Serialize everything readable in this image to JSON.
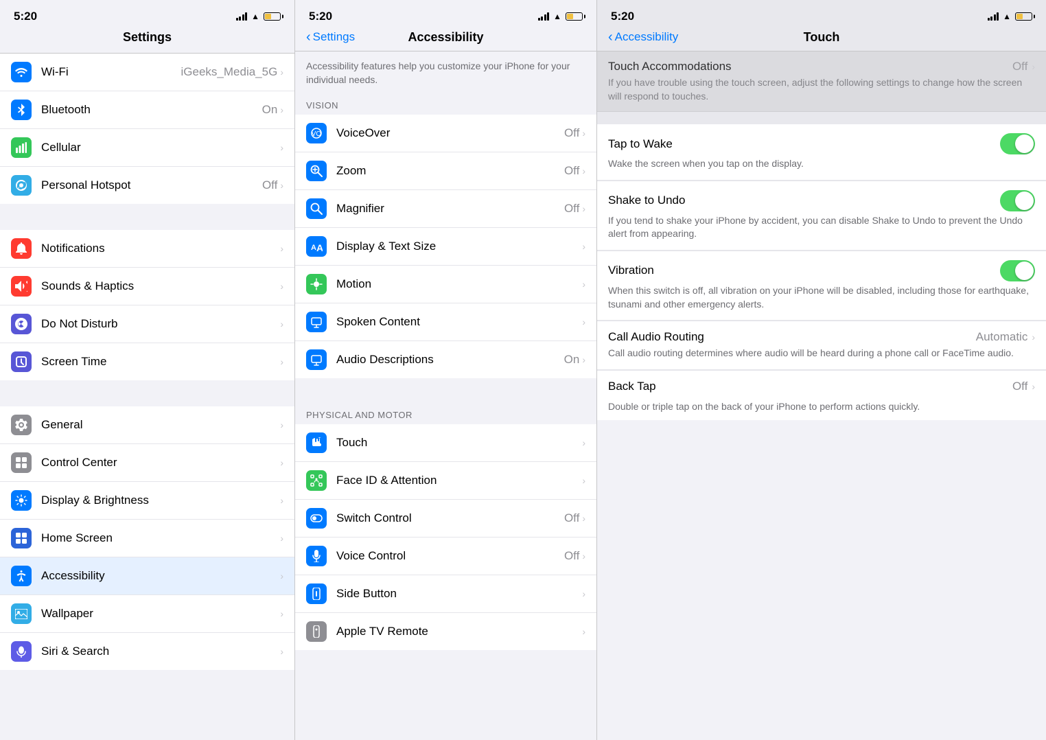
{
  "panels": {
    "left": {
      "status_time": "5:20",
      "nav_title": "Settings",
      "rows": [
        {
          "id": "wifi",
          "icon": "📶",
          "icon_color": "icon-blue",
          "label": "Wi-Fi",
          "value": "iGeeks_Media_5G",
          "has_chevron": true
        },
        {
          "id": "bluetooth",
          "icon": "🔵",
          "icon_color": "icon-blue2",
          "label": "Bluetooth",
          "value": "On",
          "has_chevron": true
        },
        {
          "id": "cellular",
          "icon": "📡",
          "icon_color": "icon-green",
          "label": "Cellular",
          "value": "",
          "has_chevron": true
        },
        {
          "id": "hotspot",
          "icon": "🔗",
          "icon_color": "icon-green2",
          "label": "Personal Hotspot",
          "value": "Off",
          "has_chevron": true
        },
        {
          "id": "notifications",
          "icon": "🔔",
          "icon_color": "icon-red",
          "label": "Notifications",
          "value": "",
          "has_chevron": true
        },
        {
          "id": "sounds",
          "icon": "🔊",
          "icon_color": "icon-red",
          "label": "Sounds & Haptics",
          "value": "",
          "has_chevron": true
        },
        {
          "id": "donotdisturb",
          "icon": "🌙",
          "icon_color": "icon-purple",
          "label": "Do Not Disturb",
          "value": "",
          "has_chevron": true
        },
        {
          "id": "screentime",
          "icon": "⏱",
          "icon_color": "icon-purple",
          "label": "Screen Time",
          "value": "",
          "has_chevron": true
        },
        {
          "id": "general",
          "icon": "⚙️",
          "icon_color": "icon-gray",
          "label": "General",
          "value": "",
          "has_chevron": true
        },
        {
          "id": "controlcenter",
          "icon": "☰",
          "icon_color": "icon-gray",
          "label": "Control Center",
          "value": "",
          "has_chevron": true
        },
        {
          "id": "displaybrightness",
          "icon": "AA",
          "icon_color": "icon-blue",
          "label": "Display & Brightness",
          "value": "",
          "has_chevron": true
        },
        {
          "id": "homescreen",
          "icon": "⊞",
          "icon_color": "icon-blue",
          "label": "Home Screen",
          "value": "",
          "has_chevron": true
        },
        {
          "id": "accessibility",
          "icon": "♿",
          "icon_color": "icon-blue",
          "label": "Accessibility",
          "value": "",
          "has_chevron": true,
          "selected": true
        },
        {
          "id": "wallpaper",
          "icon": "🖼",
          "icon_color": "icon-teal",
          "label": "Wallpaper",
          "value": "",
          "has_chevron": true
        },
        {
          "id": "siri",
          "icon": "🎙",
          "icon_color": "icon-indigo",
          "label": "Siri & Search",
          "value": "",
          "has_chevron": true
        }
      ]
    },
    "mid": {
      "status_time": "5:20",
      "back_label": "Settings",
      "nav_title": "Accessibility",
      "description": "Accessibility features help you customize your iPhone for your individual needs.",
      "section_vision": "VISION",
      "vision_items": [
        {
          "id": "voiceover",
          "label": "VoiceOver",
          "value": "Off",
          "has_chevron": true
        },
        {
          "id": "zoom",
          "label": "Zoom",
          "value": "Off",
          "has_chevron": true
        },
        {
          "id": "magnifier",
          "label": "Magnifier",
          "value": "Off",
          "has_chevron": true
        },
        {
          "id": "displaytextsize",
          "label": "Display & Text Size",
          "value": "",
          "has_chevron": true
        },
        {
          "id": "motion",
          "label": "Motion",
          "value": "",
          "has_chevron": true
        },
        {
          "id": "spokencontent",
          "label": "Spoken Content",
          "value": "",
          "has_chevron": true
        },
        {
          "id": "audiodescriptions",
          "label": "Audio Descriptions",
          "value": "On",
          "has_chevron": true
        }
      ],
      "section_physical": "PHYSICAL AND MOTOR",
      "physical_items": [
        {
          "id": "touch",
          "label": "Touch",
          "value": "",
          "has_chevron": true,
          "selected": true
        },
        {
          "id": "faceid",
          "label": "Face ID & Attention",
          "value": "",
          "has_chevron": true
        },
        {
          "id": "switchcontrol",
          "label": "Switch Control",
          "value": "Off",
          "has_chevron": true
        },
        {
          "id": "voicecontrol",
          "label": "Voice Control",
          "value": "Off",
          "has_chevron": true
        },
        {
          "id": "sidebutton",
          "label": "Side Button",
          "value": "",
          "has_chevron": true
        },
        {
          "id": "appletvremote",
          "label": "Apple TV Remote",
          "value": "",
          "has_chevron": true
        }
      ]
    },
    "right": {
      "status_time": "5:20",
      "back_label": "Accessibility",
      "nav_title": "Touch",
      "touch_accommodations_label": "Touch Accommodations",
      "touch_accommodations_value": "Off",
      "touch_accommodations_desc": "If you have trouble using the touch screen, adjust the following settings to change how the screen will respond to touches.",
      "tap_to_wake_label": "Tap to Wake",
      "tap_to_wake_desc": "Wake the screen when you tap on the display.",
      "tap_to_wake_on": true,
      "shake_to_undo_label": "Shake to Undo",
      "shake_to_undo_desc": "If you tend to shake your iPhone by accident, you can disable Shake to Undo to prevent the Undo alert from appearing.",
      "shake_to_undo_on": true,
      "vibration_label": "Vibration",
      "vibration_desc": "When this switch is off, all vibration on your iPhone will be disabled, including those for earthquake, tsunami and other emergency alerts.",
      "vibration_on": true,
      "call_audio_label": "Call Audio Routing",
      "call_audio_value": "Automatic",
      "call_audio_desc": "Call audio routing determines where audio will be heard during a phone call or FaceTime audio.",
      "back_tap_label": "Back Tap",
      "back_tap_value": "Off",
      "back_tap_desc": "Double or triple tap on the back of your iPhone to perform actions quickly."
    }
  }
}
